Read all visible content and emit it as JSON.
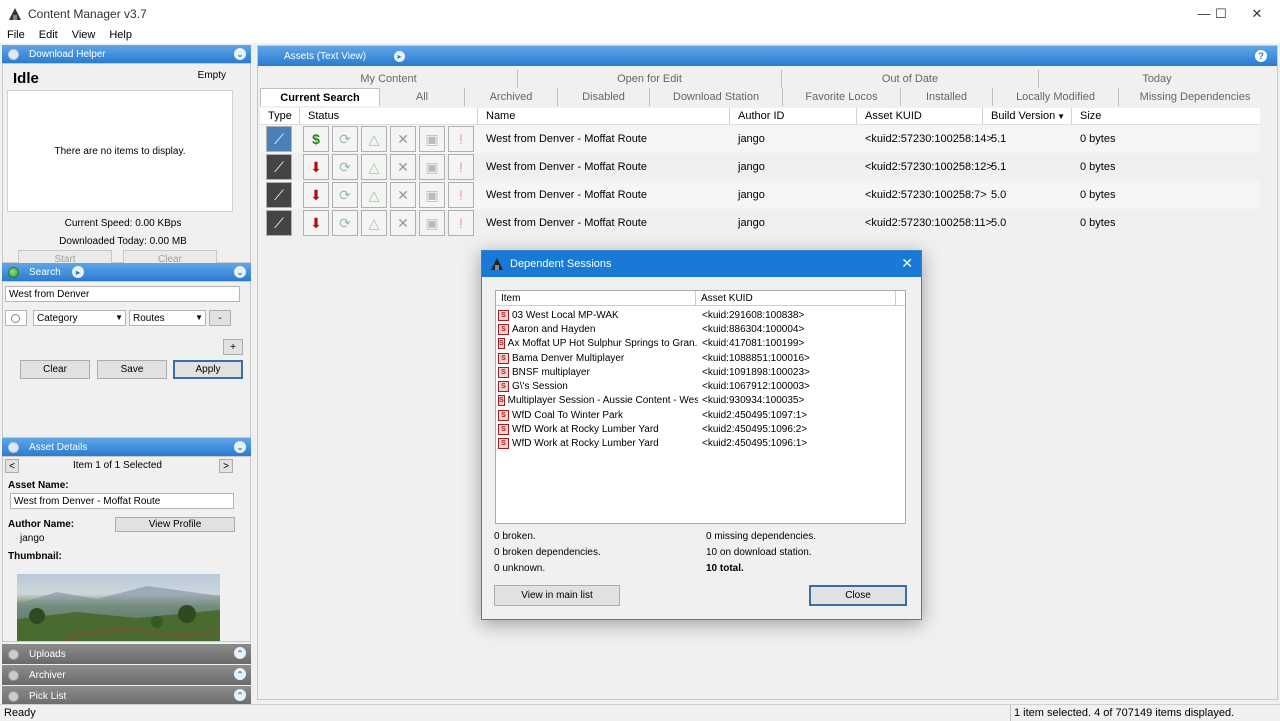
{
  "window": {
    "title": "Content Manager v3.7",
    "min": "—",
    "max": "☐",
    "close": "✕"
  },
  "menu": [
    "File",
    "Edit",
    "View",
    "Help"
  ],
  "download_helper": {
    "header": "Download Helper",
    "state": "Idle",
    "queue_state": "Empty",
    "empty_text": "There are no items to display.",
    "current_speed": "Current Speed: 0.00 KBps",
    "downloaded_today": "Downloaded Today: 0.00 MB",
    "start_label": "Start",
    "clear_label": "Clear"
  },
  "search": {
    "header": "Search",
    "query": "West from Denver",
    "field": "Category",
    "value": "Routes",
    "minus": "-",
    "plus": "+",
    "clear_label": "Clear",
    "save_label": "Save",
    "apply_label": "Apply"
  },
  "asset_details": {
    "header": "Asset Details",
    "nav_prev": "<",
    "nav_next": ">",
    "counter": "Item 1 of 1 Selected",
    "asset_name_label": "Asset Name:",
    "asset_name": "West from Denver - Moffat Route",
    "author_label": "Author Name:",
    "author": "jango",
    "view_profile": "View Profile",
    "thumbnail_label": "Thumbnail:"
  },
  "collapsed_panels": [
    "Uploads",
    "Archiver",
    "Pick List"
  ],
  "assets": {
    "header": "Assets (Text View)",
    "tabs_row1": [
      "My Content",
      "Open for Edit",
      "Out of Date",
      "Today"
    ],
    "tabs_row2": [
      "Current Search",
      "All",
      "Archived",
      "Disabled",
      "Download Station",
      "Favorite Locos",
      "Installed",
      "Locally Modified",
      "Missing Dependencies"
    ],
    "columns": [
      "Type",
      "Status",
      "Name",
      "Author ID",
      "Asset KUID",
      "Build Version",
      "Size"
    ],
    "rows": [
      {
        "name": "West from Denver - Moffat Route",
        "author": "jango",
        "kuid": "<kuid2:57230:100258:14>",
        "build": "5.1",
        "size": "0 bytes",
        "status_icon": "dollar-icon"
      },
      {
        "name": "West from Denver - Moffat Route",
        "author": "jango",
        "kuid": "<kuid2:57230:100258:12>",
        "build": "5.1",
        "size": "0 bytes",
        "status_icon": "download-box-icon"
      },
      {
        "name": "West from Denver - Moffat Route",
        "author": "jango",
        "kuid": "<kuid2:57230:100258:7>",
        "build": "5.0",
        "size": "0 bytes",
        "status_icon": "download-box-icon"
      },
      {
        "name": "West from Denver - Moffat Route",
        "author": "jango",
        "kuid": "<kuid2:57230:100258:11>",
        "build": "5.0",
        "size": "0 bytes",
        "status_icon": "download-box-icon"
      }
    ]
  },
  "dialog": {
    "title": "Dependent Sessions",
    "col_item": "Item",
    "col_kuid": "Asset KUID",
    "items": [
      {
        "name": "03 West Local MP-WAK",
        "kuid": "<kuid:291608:100838>"
      },
      {
        "name": "Aaron and Hayden",
        "kuid": "<kuid:886304:100004>"
      },
      {
        "name": "Ax Moffat UP Hot Sulphur Springs to Gran...",
        "kuid": "<kuid:417081:100199>"
      },
      {
        "name": "Bama Denver Multiplayer",
        "kuid": "<kuid:1088851:100016>"
      },
      {
        "name": "BNSF multiplayer",
        "kuid": "<kuid:1091898:100023>"
      },
      {
        "name": "G\\'s Session",
        "kuid": "<kuid:1067912:100003>"
      },
      {
        "name": "Multiplayer Session - Aussie Content - West",
        "kuid": "<kuid:930934:100035>"
      },
      {
        "name": "WfD Coal To Winter Park",
        "kuid": "<kuid2:450495:1097:1>"
      },
      {
        "name": "WfD Work at Rocky Lumber Yard",
        "kuid": "<kuid2:450495:1096:2>"
      },
      {
        "name": "WfD Work at Rocky Lumber Yard",
        "kuid": "<kuid2:450495:1096:1>"
      }
    ],
    "broken": "0 broken.",
    "broken_deps": "0 broken dependencies.",
    "unknown": "0 unknown.",
    "missing": "0 missing dependencies.",
    "on_station": "10 on download station.",
    "total": "10 total.",
    "view_btn": "View in main list",
    "close_btn": "Close"
  },
  "status": {
    "left": "Ready",
    "right": "1 item selected. 4 of 707149 items displayed."
  },
  "colors": {
    "accent": "#2b7bd1",
    "dialog_title": "#1879d6"
  }
}
